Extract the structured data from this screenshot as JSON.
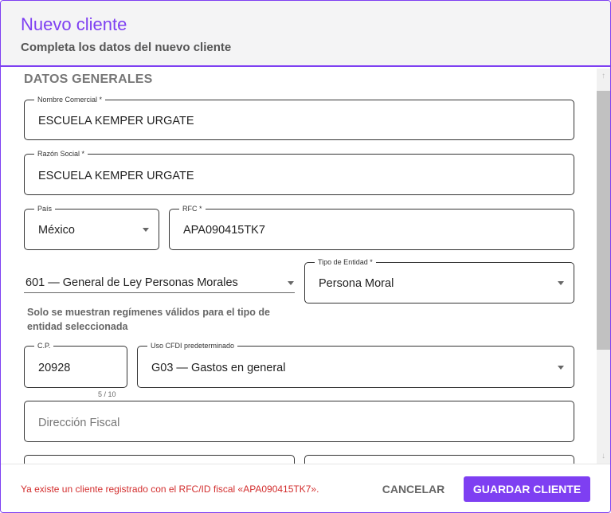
{
  "dialog": {
    "title": "Nuevo cliente",
    "subtitle": "Completa los datos del nuevo cliente"
  },
  "section": {
    "title": "DATOS GENERALES"
  },
  "fields": {
    "nombre_comercial": {
      "label": "Nombre Comercial *",
      "value": "ESCUELA KEMPER URGATE"
    },
    "razon_social": {
      "label": "Razón Social *",
      "value": "ESCUELA KEMPER URGATE"
    },
    "pais": {
      "label": "País",
      "value": "México"
    },
    "rfc": {
      "label": "RFC *",
      "value": "APA090415TK7"
    },
    "regimen": {
      "value": "601 — General de Ley Personas Morales"
    },
    "tipo_entidad": {
      "label": "Tipo de Entidad *",
      "value": "Persona Moral"
    },
    "cp": {
      "label": "C.P.",
      "value": "20928",
      "counter": "5 / 10"
    },
    "uso_cfdi": {
      "label": "Uso CFDI predeterminado",
      "value": "G03 — Gastos en general"
    },
    "direccion": {
      "placeholder": "Dirección Fiscal"
    }
  },
  "hint": "Solo se muestran regímenes válidos para el tipo de entidad seleccionada",
  "footer": {
    "error": "Ya existe un cliente registrado con el RFC/ID fiscal «APA090415TK7».",
    "cancel_label": "CANCELAR",
    "save_label": "GUARDAR CLIENTE"
  },
  "colors": {
    "accent": "#7e3ff2",
    "error": "#d32f2f"
  }
}
